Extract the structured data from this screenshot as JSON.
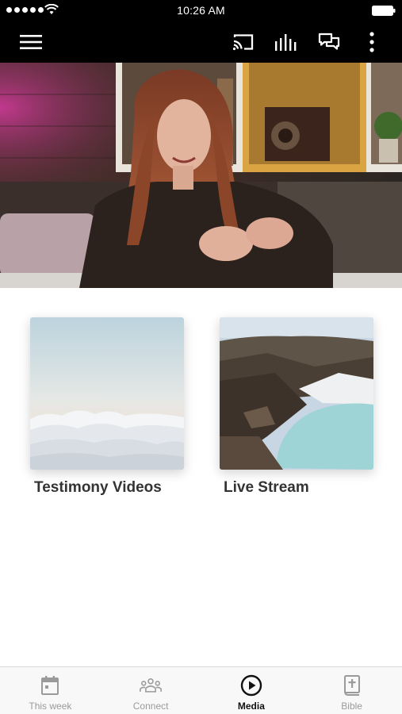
{
  "status_bar": {
    "time": "10:26 AM"
  },
  "app_bar": {
    "icons": [
      "menu-icon",
      "cast-icon",
      "audio-bars-icon",
      "chat-icon",
      "more-vertical-icon"
    ]
  },
  "hero": {
    "image": "woman-speaking-photo"
  },
  "media": {
    "items": [
      {
        "label": "Testimony Videos",
        "image": "clouds-photo"
      },
      {
        "label": "Live Stream",
        "image": "crater-lake-photo"
      }
    ]
  },
  "tab_bar": {
    "tabs": [
      {
        "label": "This week",
        "icon": "calendar-icon",
        "active": false
      },
      {
        "label": "Connect",
        "icon": "group-icon",
        "active": false
      },
      {
        "label": "Media",
        "icon": "play-circle-icon",
        "active": true
      },
      {
        "label": "Bible",
        "icon": "bible-icon",
        "active": false
      }
    ]
  },
  "colors": {
    "bar_background": "#000000",
    "tab_active": "#111111",
    "tab_inactive": "#9a9a9a",
    "label_text": "#333333"
  }
}
